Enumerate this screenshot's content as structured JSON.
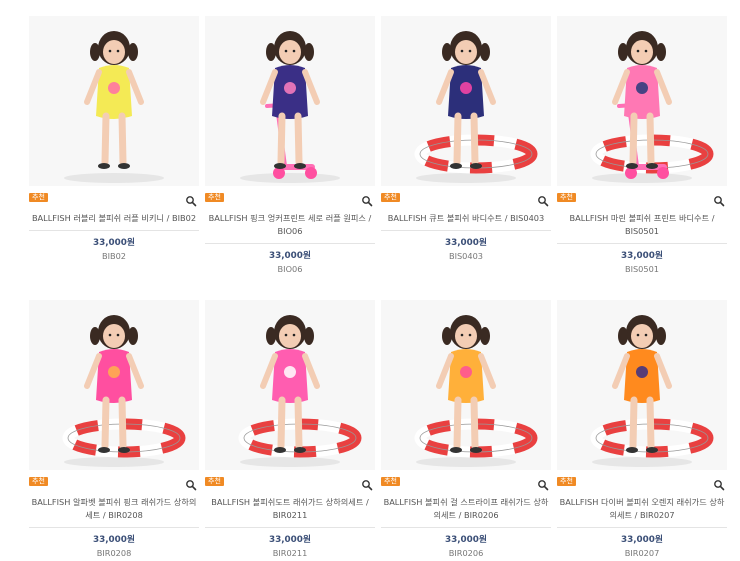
{
  "badge_label": "추천",
  "products": [
    {
      "name": "BALLFISH 러블리 볼피쉬 러플 비키니 / BIB02",
      "price": "33,000원",
      "code": "BIB02",
      "outfit": "#f4ea55",
      "accent": "#ff6fa8",
      "prop": "none"
    },
    {
      "name": "BALLFISH 핑크 엉커프린트 세로 러플 원피스 / BIO06",
      "price": "33,000원",
      "code": "BIO06",
      "outfit": "#3a2f86",
      "accent": "#ff7fbf",
      "prop": "scooter"
    },
    {
      "name": "BALLFISH 큐트 볼피쉬 바디수트 / BIS0403",
      "price": "33,000원",
      "code": "BIS0403",
      "outfit": "#2c2f7a",
      "accent": "#ff45a8",
      "prop": "ring"
    },
    {
      "name": "BALLFISH 마린 볼피쉬 프린트 바디수트 / BIS0501",
      "price": "33,000원",
      "code": "BIS0501",
      "outfit": "#ff78b4",
      "accent": "#273a7a",
      "prop": "scooter-ring"
    },
    {
      "name": "BALLFISH 알파벳 볼피쉬 핑크 래쉬가드 상하의 세트 / BIR0208",
      "price": "33,000원",
      "code": "BIR0208",
      "outfit": "#ff4fa0",
      "accent": "#ffb24a",
      "prop": "ring"
    },
    {
      "name": "BALLFISH 볼피쉬도트 래쉬가드 상하의세트 / BIR0211",
      "price": "33,000원",
      "code": "BIR0211",
      "outfit": "#ff5db0",
      "accent": "#ffffff",
      "prop": "ring"
    },
    {
      "name": "BALLFISH 볼피쉬 걸 스트라이프 래쉬가드 상하의세트 / BIR0206",
      "price": "33,000원",
      "code": "BIR0206",
      "outfit": "#ffb03a",
      "accent": "#ff4f9a",
      "prop": "ring"
    },
    {
      "name": "BALLFISH 다이버 볼피쉬 오렌지 래쉬가드 상하의세트 / BIR0207",
      "price": "33,000원",
      "code": "BIR0207",
      "outfit": "#ff8a1e",
      "accent": "#3a2f86",
      "prop": "ring"
    }
  ]
}
